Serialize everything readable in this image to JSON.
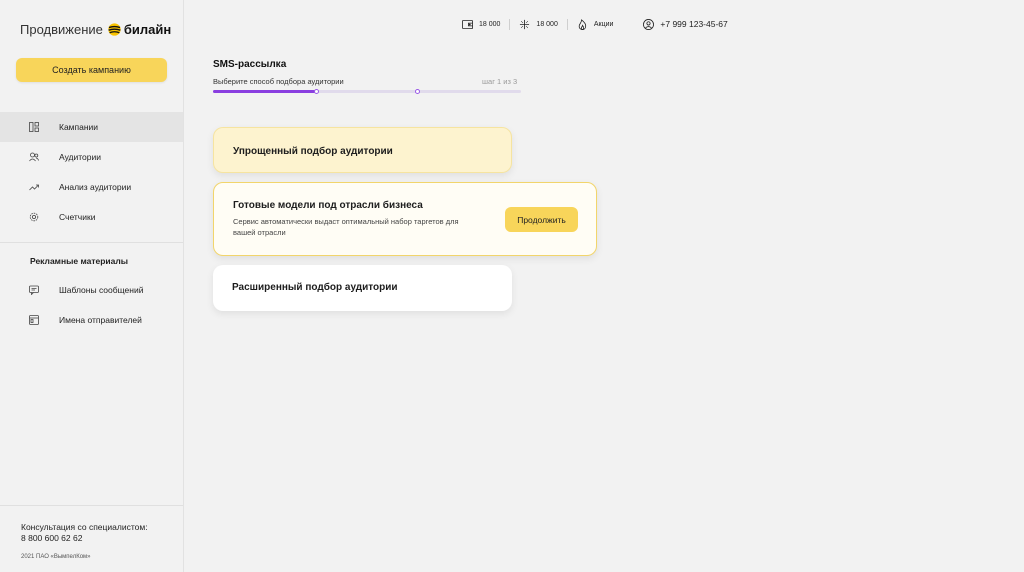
{
  "logo": {
    "text": "Продвижение",
    "brand": "билайн"
  },
  "sidebar": {
    "create_button": "Создать кампанию",
    "items": [
      {
        "label": "Кампании",
        "icon": "campaigns-icon",
        "active": true
      },
      {
        "label": "Аудитории",
        "icon": "users-icon"
      },
      {
        "label": "Анализ аудитории",
        "icon": "chart-trend-icon"
      },
      {
        "label": "Счетчики",
        "icon": "gear-icon"
      }
    ],
    "section_title": "Рекламные материалы",
    "materials": [
      {
        "label": "Шаблоны сообщений",
        "icon": "message-icon"
      },
      {
        "label": "Имена отправителей",
        "icon": "sender-icon"
      }
    ],
    "consult_label": "Консультация со специалистом:",
    "consult_phone": "8 800 600 62 62",
    "copyright": "2021 ПАО «ВымпелКом»"
  },
  "topbar": {
    "wallet": "18 000",
    "bonus": "18 000",
    "promo": "Акции",
    "phone": "+7 999 123-45-67"
  },
  "main": {
    "title": "SMS-рассылка",
    "subtitle": "Выберите способ подбора аудитории",
    "step": "шаг 1 из 3",
    "progress_fraction": 0.33,
    "options": [
      {
        "title": "Упрощенный подбор аудитории"
      },
      {
        "title": "Готовые модели под отрасли бизнеса",
        "description": "Сервис автоматически выдаст оптимальный набор таргетов для вашей отрасли",
        "button": "Продолжить"
      },
      {
        "title": "Расширенный подбор аудитории"
      }
    ]
  },
  "colors": {
    "accent": "#f8d55a",
    "progress": "#8a3fe0"
  }
}
